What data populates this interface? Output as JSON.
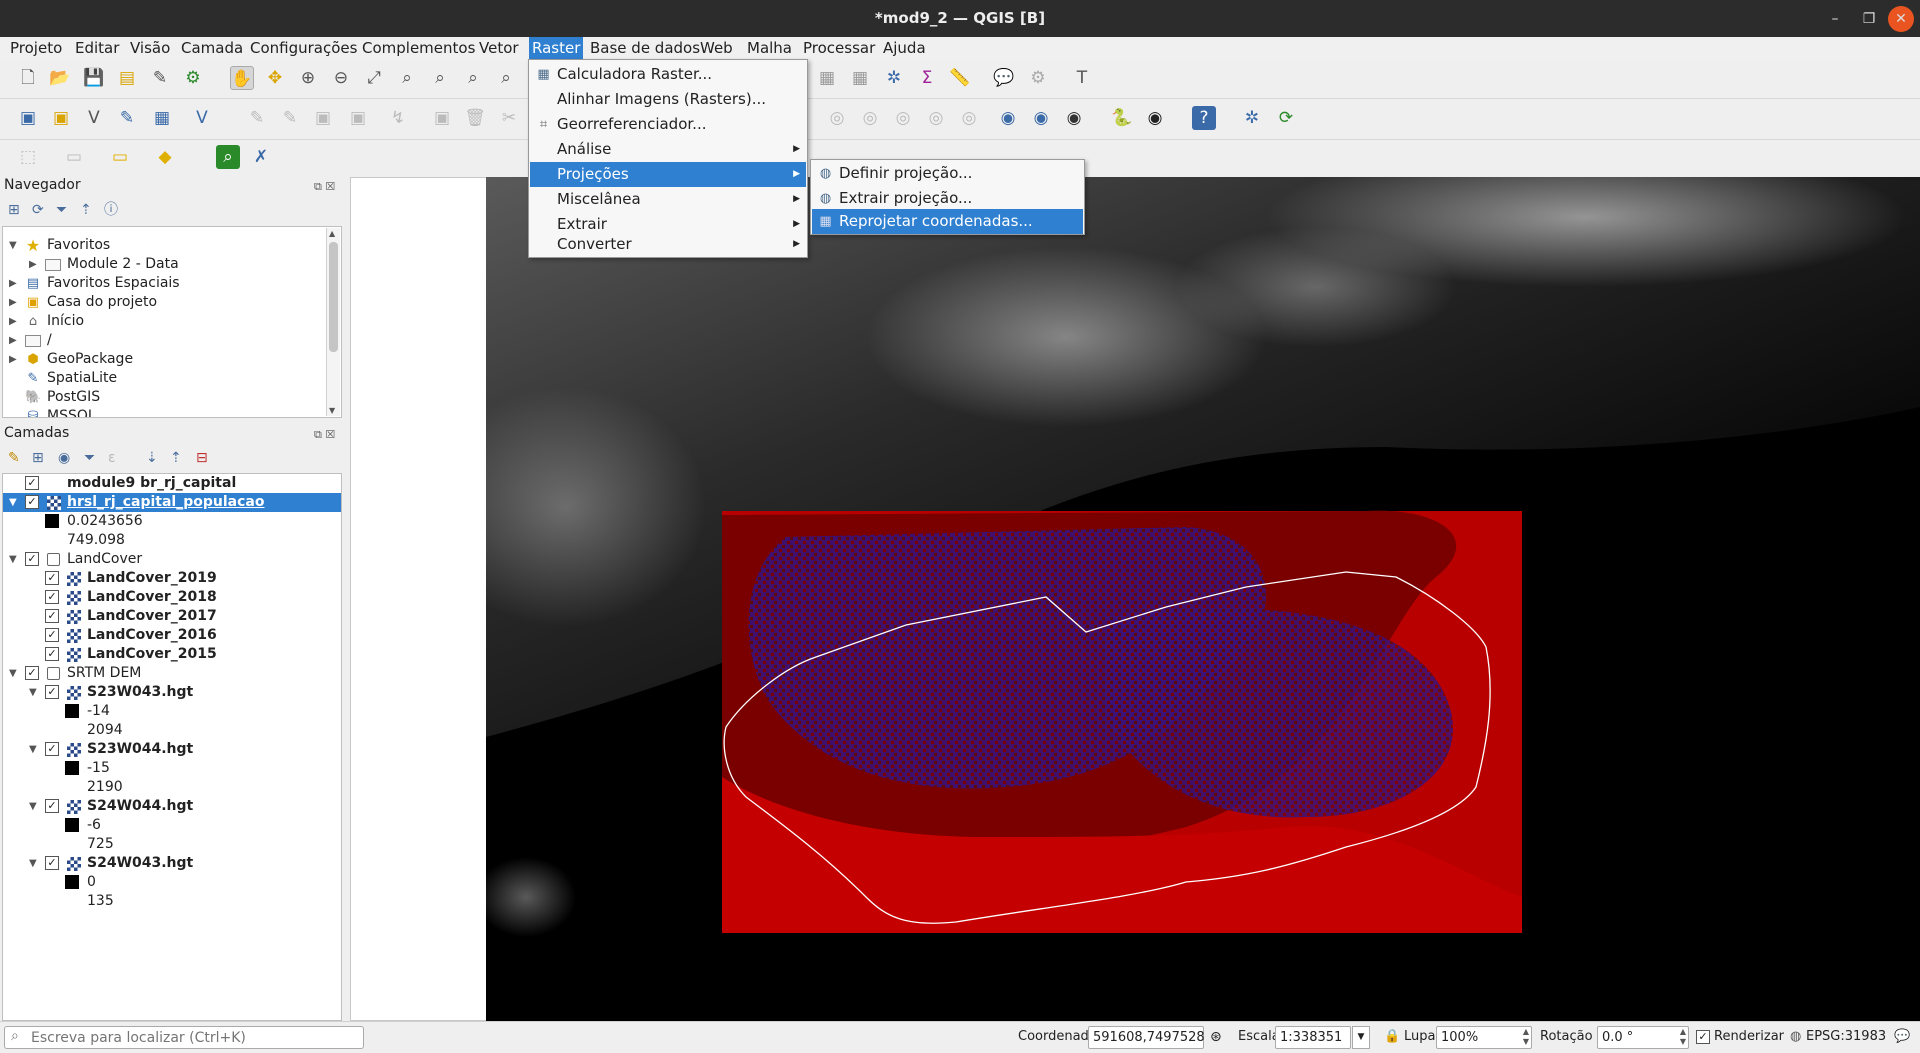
{
  "window": {
    "title": "*mod9_2 — QGIS [B]"
  },
  "menubar": {
    "items": [
      "Projeto",
      "Editar",
      "Visão",
      "Camada",
      "Configurações",
      "Complementos",
      "Vetor",
      "Raster",
      "Base de dados",
      "Web",
      "Malha",
      "Processar",
      "Ajuda"
    ],
    "active": "Raster"
  },
  "raster_menu": {
    "items": [
      {
        "label": "Calculadora Raster...",
        "icon": "raster-calculator-icon",
        "submenu": false
      },
      {
        "label": "Alinhar Imagens (Rasters)...",
        "icon": "",
        "submenu": false
      },
      {
        "label": "Georreferenciador...",
        "icon": "georeferencer-icon",
        "submenu": false
      },
      {
        "label": "Análise",
        "icon": "",
        "submenu": true
      },
      {
        "label": "Projeções",
        "icon": "",
        "submenu": true,
        "highlighted": true
      },
      {
        "label": "Miscelânea",
        "icon": "",
        "submenu": true
      },
      {
        "label": "Extrair",
        "icon": "",
        "submenu": true
      },
      {
        "label": "Converter",
        "icon": "",
        "submenu": true
      }
    ]
  },
  "projections_menu": {
    "items": [
      {
        "label": "Definir projeção...",
        "icon": "projection-icon"
      },
      {
        "label": "Extrair projeção...",
        "icon": "projection-icon"
      },
      {
        "label": "Reprojetar coordenadas...",
        "icon": "projection-icon",
        "highlighted": true
      }
    ]
  },
  "navigator": {
    "title": "Navegador",
    "items": [
      {
        "label": "Favoritos",
        "icon": "star-icon",
        "level": 0,
        "expanded": true
      },
      {
        "label": "Module 2 - Data",
        "icon": "folder-icon",
        "level": 1
      },
      {
        "label": "Favoritos Espaciais",
        "icon": "spatial-bookmark-icon",
        "level": 0
      },
      {
        "label": "Casa do projeto",
        "icon": "project-home-icon",
        "level": 0
      },
      {
        "label": "Início",
        "icon": "home-icon",
        "level": 0
      },
      {
        "label": "/",
        "icon": "folder-icon",
        "level": 0
      },
      {
        "label": "GeoPackage",
        "icon": "geopackage-icon",
        "level": 0
      },
      {
        "label": "SpatiaLite",
        "icon": "spatialite-icon",
        "level": 0
      },
      {
        "label": "PostGIS",
        "icon": "postgis-icon",
        "level": 0
      },
      {
        "label": "MSSQL",
        "icon": "mssql-icon",
        "level": 0
      }
    ]
  },
  "layers": {
    "title": "Camadas",
    "items": [
      {
        "label": "module9 br_rj_capital",
        "bold": true
      },
      {
        "label": "hrsl_rj_capital_populacao",
        "bold": true,
        "selected": true
      },
      {
        "label": "0.0243656"
      },
      {
        "label": "749.098"
      },
      {
        "label": "LandCover"
      },
      {
        "label": "LandCover_2019",
        "bold": true
      },
      {
        "label": "LandCover_2018",
        "bold": true
      },
      {
        "label": "LandCover_2017",
        "bold": true
      },
      {
        "label": "LandCover_2016",
        "bold": true
      },
      {
        "label": "LandCover_2015",
        "bold": true
      },
      {
        "label": "SRTM DEM"
      },
      {
        "label": "S23W043.hgt",
        "bold": true
      },
      {
        "label": "-14"
      },
      {
        "label": "2094"
      },
      {
        "label": "S23W044.hgt",
        "bold": true
      },
      {
        "label": "-15"
      },
      {
        "label": "2190"
      },
      {
        "label": "S24W044.hgt",
        "bold": true
      },
      {
        "label": "-6"
      },
      {
        "label": "725"
      },
      {
        "label": "S24W043.hgt",
        "bold": true
      },
      {
        "label": "0"
      },
      {
        "label": "135"
      }
    ]
  },
  "statusbar": {
    "locator_placeholder": "Escreva para localizar (Ctrl+K)",
    "coord_label": "Coordenada",
    "coord_value": "591608,7497528",
    "scale_label": "Escala",
    "scale_value": "1:338351",
    "magnifier_label": "Lupa",
    "magnifier_value": "100%",
    "rotation_label": "Rotação",
    "rotation_value": "0.0 °",
    "render_label": "Renderizar",
    "crs": "EPSG:31983"
  }
}
